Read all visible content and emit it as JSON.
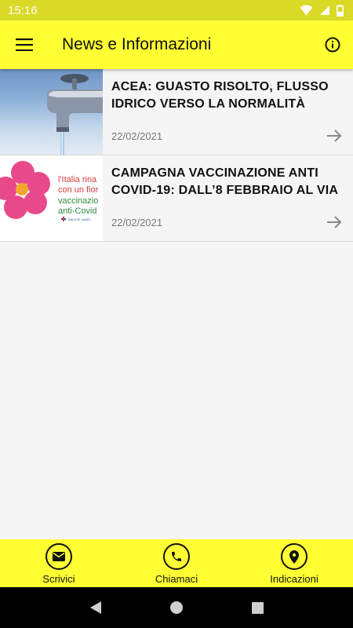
{
  "status_bar": {
    "time": "15:16"
  },
  "app_bar": {
    "title": "News e Informazioni"
  },
  "news": [
    {
      "title": "ACEA: GUASTO RISOLTO, FLUSSO IDRICO VERSO LA NORMALITÀ",
      "date": "22/02/2021"
    },
    {
      "title": "CAMPAGNA VACCINAZIONE ANTI COVID-19: DALL’8 FEBBRAIO AL VIA",
      "date": "22/02/2021",
      "thumb_text": {
        "line1": "l'Italia rina",
        "line2": "con un fior",
        "line3": "vaccinazio",
        "line4": "anti-Covid",
        "brand": "SALUTE LAZIO"
      }
    }
  ],
  "bottom_nav": [
    {
      "label": "Scrivici",
      "icon": "mail-icon"
    },
    {
      "label": "Chiamaci",
      "icon": "phone-icon"
    },
    {
      "label": "Indicazioni",
      "icon": "location-pin-icon"
    }
  ],
  "colors": {
    "accent": "#ffff33",
    "status_bar": "#d9d926",
    "background": "#f5f5f5",
    "vax_red": "#d63a3a",
    "vax_green": "#2e8b3e",
    "vax_flower": "#e8498a"
  }
}
